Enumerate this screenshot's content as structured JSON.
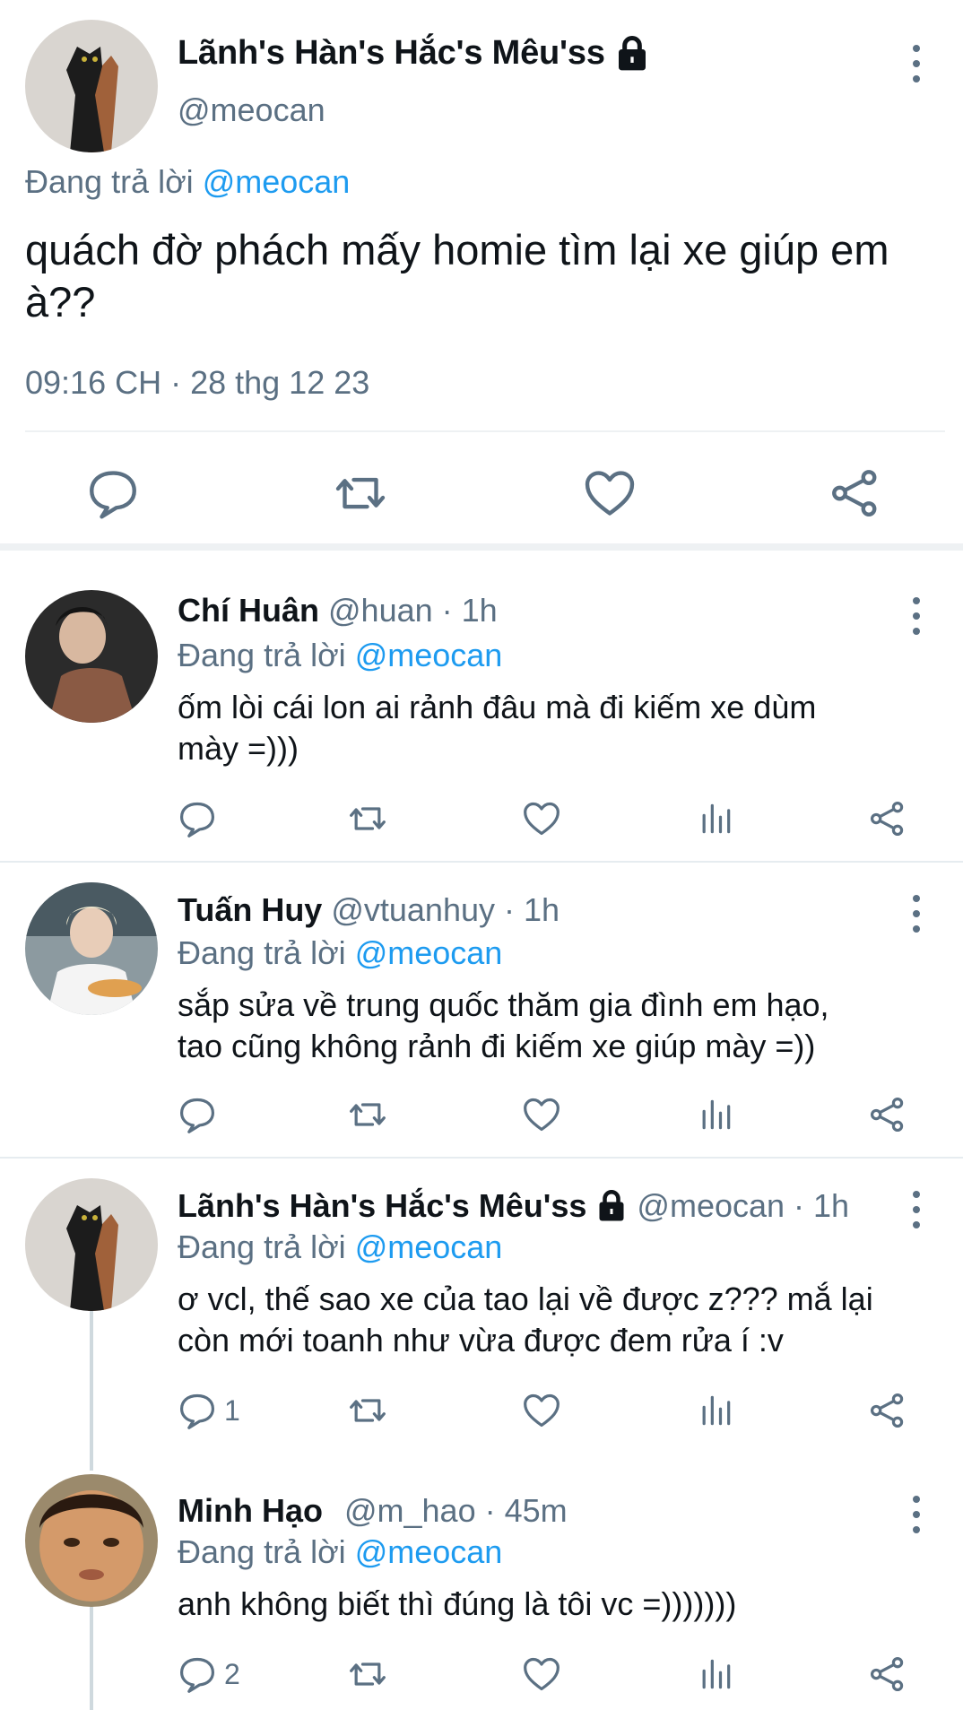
{
  "main_tweet": {
    "display_name": "Lãnh's Hàn's Hắc's Mêu'ss",
    "handle": "@meocan",
    "replying_prefix": "Đang trả lời",
    "replying_to": "@meocan",
    "text": "quách đờ phách mấy homie tìm lại xe giúp em à??",
    "timestamp": "09:16 CH · 28 thg 12 23",
    "actions": [
      "reply-icon",
      "retweet-icon",
      "like-icon",
      "share-icon"
    ]
  },
  "replies": [
    {
      "display_name": "Chí Huân",
      "handle": "@huan",
      "time": "1h",
      "replying_prefix": "Đang trả lời",
      "replying_to": "@meocan",
      "text_lines": [
        "ốm lòi cái lon ai rảnh đâu mà đi kiếm xe dùm",
        "mày =)))"
      ],
      "reply_count": "",
      "protected": false
    },
    {
      "display_name": "Tuấn Huy",
      "handle": "@vtuanhuy",
      "time": "1h",
      "replying_prefix": "Đang trả lời",
      "replying_to": "@meocan",
      "text_lines": [
        "sắp sửa về trung quốc thăm gia đình em hạo,",
        "tao cũng không rảnh đi kiếm xe giúp mày =))"
      ],
      "reply_count": "",
      "protected": false
    },
    {
      "display_name": "Lãnh's Hàn's Hắc's Mêu'ss",
      "handle": "@meocan",
      "time": "1h",
      "replying_prefix": "Đang trả lời",
      "replying_to": "@meocan",
      "text_lines": [
        "ơ vcl, thế sao xe của tao lại về được z??? mắ lại",
        "còn mới toanh như vừa được đem rửa í :v"
      ],
      "reply_count": "1",
      "protected": true
    },
    {
      "display_name": "Minh Hạo",
      "handle": "@m_hao",
      "time": "45m",
      "replying_prefix": "Đang trả lời",
      "replying_to": "@meocan",
      "text_lines": [
        "anh không biết thì đúng là tôi vc =)))))))"
      ],
      "reply_count": "2",
      "protected": false
    }
  ],
  "colors": {
    "accent": "#1d9bf0",
    "secondary_text": "#5b7083",
    "divider": "#e6ecf0"
  }
}
